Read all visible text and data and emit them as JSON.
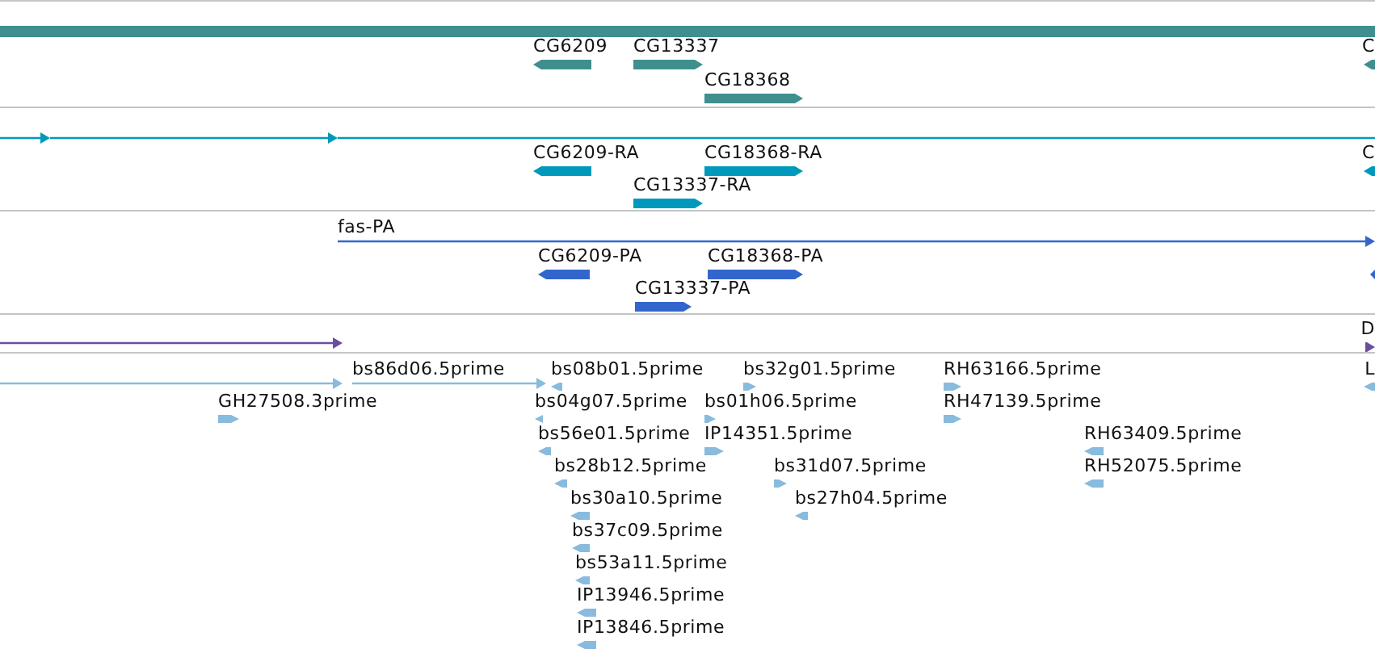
{
  "tracks": [
    {
      "kind": "gene",
      "color": "#3f8f8f",
      "features": [
        {
          "kind": "band"
        },
        {
          "kind": "block",
          "label": "CG6209",
          "reverse": true
        },
        {
          "kind": "block",
          "label": "CG13337",
          "reverse": false
        },
        {
          "kind": "block",
          "label": "CG18368",
          "reverse": false
        },
        {
          "kind": "block",
          "label": "C",
          "reverse": true
        }
      ]
    },
    {
      "kind": "transcript",
      "color": "#0099bb",
      "features": [
        {
          "kind": "line",
          "reverse": false
        },
        {
          "kind": "line",
          "reverse": false
        },
        {
          "kind": "line"
        },
        {
          "kind": "block",
          "label": "CG6209-RA",
          "reverse": true
        },
        {
          "kind": "block",
          "label": "CG18368-RA",
          "reverse": false
        },
        {
          "kind": "block",
          "label": "CG13337-RA",
          "reverse": false
        },
        {
          "kind": "block",
          "label": "C",
          "reverse": true
        }
      ]
    },
    {
      "kind": "protein",
      "color": "#3366cc",
      "features": [
        {
          "kind": "line",
          "label": "fas-PA",
          "reverse": false
        },
        {
          "kind": "block",
          "label": "CG6209-PA",
          "reverse": true
        },
        {
          "kind": "block",
          "label": "CG18368-PA",
          "reverse": false
        },
        {
          "kind": "block",
          "label": "CG13337-PA",
          "reverse": false
        },
        {
          "kind": "block",
          "reverse": true
        }
      ]
    },
    {
      "kind": "other",
      "color": "#6a4fa0",
      "features": [
        {
          "kind": "line",
          "reverse": false
        },
        {
          "kind": "block",
          "label": "D",
          "reverse": false
        }
      ]
    },
    {
      "kind": "est",
      "color": "#88bbdd",
      "features": [
        {
          "kind": "line",
          "reverse": false
        },
        {
          "kind": "line",
          "label": "bs86d06.5prime",
          "reverse": false
        },
        {
          "kind": "block",
          "label": "bs08b01.5prime",
          "reverse": true
        },
        {
          "kind": "block",
          "label": "bs32g01.5prime",
          "reverse": false
        },
        {
          "kind": "block",
          "label": "RH63166.5prime",
          "reverse": false
        },
        {
          "kind": "block",
          "label": "L",
          "reverse": true
        },
        {
          "kind": "block",
          "label": "GH27508.3prime",
          "reverse": false
        },
        {
          "kind": "block",
          "label": "bs04g07.5prime",
          "reverse": true
        },
        {
          "kind": "block",
          "label": "bs01h06.5prime",
          "reverse": false
        },
        {
          "kind": "block",
          "label": "RH47139.5prime",
          "reverse": false
        },
        {
          "kind": "block",
          "label": "bs56e01.5prime",
          "reverse": true
        },
        {
          "kind": "block",
          "label": "IP14351.5prime",
          "reverse": false
        },
        {
          "kind": "block",
          "label": "RH63409.5prime",
          "reverse": true
        },
        {
          "kind": "block",
          "label": "bs28b12.5prime",
          "reverse": true
        },
        {
          "kind": "block",
          "label": "bs31d07.5prime",
          "reverse": false
        },
        {
          "kind": "block",
          "label": "RH52075.5prime",
          "reverse": true
        },
        {
          "kind": "block",
          "label": "bs30a10.5prime",
          "reverse": true
        },
        {
          "kind": "block",
          "label": "bs27h04.5prime",
          "reverse": true
        },
        {
          "kind": "block",
          "label": "bs37c09.5prime",
          "reverse": true
        },
        {
          "kind": "block",
          "label": "bs53a11.5prime",
          "reverse": true
        },
        {
          "kind": "block",
          "label": "IP13946.5prime",
          "reverse": true
        },
        {
          "kind": "block",
          "label": "IP13846.5prime",
          "reverse": true
        }
      ]
    }
  ]
}
